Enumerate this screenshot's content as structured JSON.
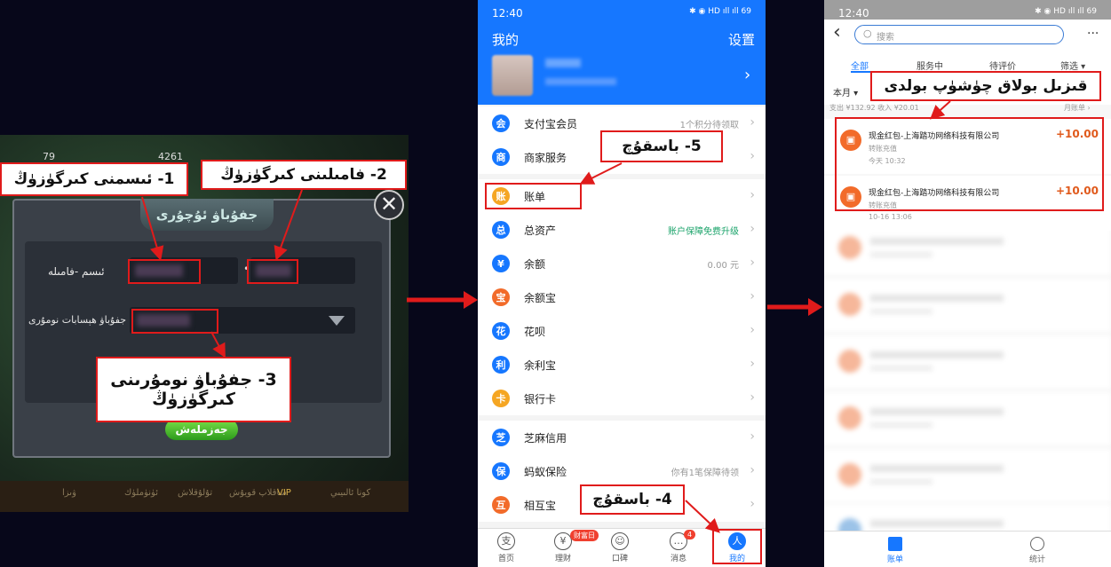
{
  "panel1": {
    "top_numbers": [
      "79",
      "4261"
    ],
    "dialog_title": "جفۇباۋ ئۇچۇرى",
    "name_label": "ئىسم -فامىله",
    "account_label": "جفۇباۋ ھېسابات نومۇرى",
    "confirm_label": "جەزملەش",
    "close_glyph": "✕",
    "bottom_tabs": [
      "ۋىزا",
      "ئۈنۈملۈك",
      "تۇلۇقلاش",
      "ساقلاپ قويۇش",
      "VIP",
      "كونا ئالىيىي"
    ],
    "callouts": {
      "step1": "1- ئىسمنى كىرگۈزۈڭ",
      "step2": "2- فامىلىنى كىرگۈزۈڭ",
      "step3_line1": "3- جفۇباۋ نومۇرىنى",
      "step3_line2": "كىرگۈزۈڭ"
    }
  },
  "panel2": {
    "time": "12:40",
    "status_icons": "✱ ◉ HD ıll ıll 69",
    "title": "我的",
    "settings": "设置",
    "menu": [
      {
        "label": "支付宝会员",
        "meta": "1个积分待领取",
        "icon": "会",
        "color": "#1677ff"
      },
      {
        "label": "商家服务",
        "meta": "",
        "icon": "商",
        "color": "#1677ff"
      },
      {
        "label": "账单",
        "meta": "",
        "icon": "账",
        "color": "#f5a623"
      },
      {
        "label": "总资产",
        "meta": "账户保障免费升级",
        "icon": "总",
        "color": "#1677ff"
      },
      {
        "label": "余额",
        "meta": "0.00 元",
        "icon": "¥",
        "color": "#1677ff"
      },
      {
        "label": "余额宝",
        "meta": "",
        "icon": "宝",
        "color": "#f26b2a"
      },
      {
        "label": "花呗",
        "meta": "",
        "icon": "花",
        "color": "#1677ff"
      },
      {
        "label": "余利宝",
        "meta": "",
        "icon": "利",
        "color": "#1677ff"
      },
      {
        "label": "银行卡",
        "meta": "",
        "icon": "卡",
        "color": "#f5a623"
      },
      {
        "label": "芝麻信用",
        "meta": "",
        "icon": "芝",
        "color": "#1677ff"
      },
      {
        "label": "蚂蚁保险",
        "meta": "你有1笔保障待领",
        "icon": "保",
        "color": "#1677ff"
      },
      {
        "label": "相互宝",
        "meta": "",
        "icon": "互",
        "color": "#f26b2a"
      }
    ],
    "tabs": [
      {
        "label": "首页",
        "glyph": "支"
      },
      {
        "label": "理财",
        "glyph": "¥"
      },
      {
        "label": "口碑",
        "glyph": "☺"
      },
      {
        "label": "消息",
        "glyph": "…"
      },
      {
        "label": "我的",
        "glyph": "人"
      }
    ],
    "badge_wealth": "财富日",
    "badge_msg": "4",
    "callouts": {
      "step5": "5- باسقۇچ",
      "step4": "4- باسقۇچ"
    }
  },
  "panel3": {
    "time": "12:40",
    "status_icons": "✱ ◉ HD ıll ıll 69",
    "search_placeholder": "搜索",
    "more": "···",
    "back": "‹",
    "filters": [
      "全部",
      "服务中",
      "待评价",
      "筛选 ▾"
    ],
    "month": "本月 ▾",
    "summary": "支出 ¥132.92   收入 ¥20.01",
    "monthly_bill": "月账单 ›",
    "bills": [
      {
        "name": "现金红包-上海踏功网络科技有限公司",
        "sub": "转账充值",
        "date": "今天  10:32",
        "amount": "+10.00"
      },
      {
        "name": "现金红包-上海踏功网络科技有限公司",
        "sub": "转账充值",
        "date": "10-16  13:06",
        "amount": "+10.00"
      }
    ],
    "tabs": [
      "账单",
      "统计"
    ],
    "callout": "قىزىل بولاق چۈشۈپ بولدى"
  }
}
